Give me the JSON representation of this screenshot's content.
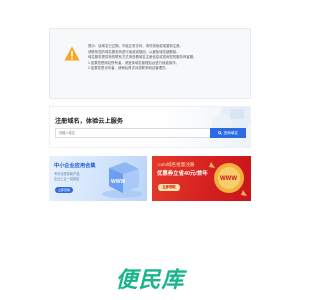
{
  "notice": {
    "icon": "warning-icon",
    "lines": [
      "提示：该域名已过期，不能正常访问，请尽快续费或重新注册。",
      "请联系您的域名服务商进行续费或赎回，以避免域名被删除。",
      "域名服务提供商的联系方式请查看域名注册信息或咨询您的服务商客服。",
      "1.如果您是网站所有者，请登录域名管理后台进行续费操作。",
      "2.如果您是访问者，请稍后再访问或联系网站管理员。"
    ],
    "accent_color": "#f5a623"
  },
  "search": {
    "title": "注册域名，体验云上服务",
    "placeholder": "请输入域名",
    "button_label": "查询域名",
    "button_icon": "search-icon"
  },
  "banners": [
    {
      "title": "中小企业应用合集",
      "sub1": "专享优惠多款产品",
      "sub2": "企业上云一站搞定",
      "button": "立即查看",
      "art_text": "WWW"
    },
    {
      "title": ".com域名批量注册",
      "sub1": "优惠券立省40元/首年",
      "button": "立即领取",
      "art_text": "WWW"
    }
  ],
  "logo": {
    "text": "便民库",
    "color": "#18b58c"
  }
}
